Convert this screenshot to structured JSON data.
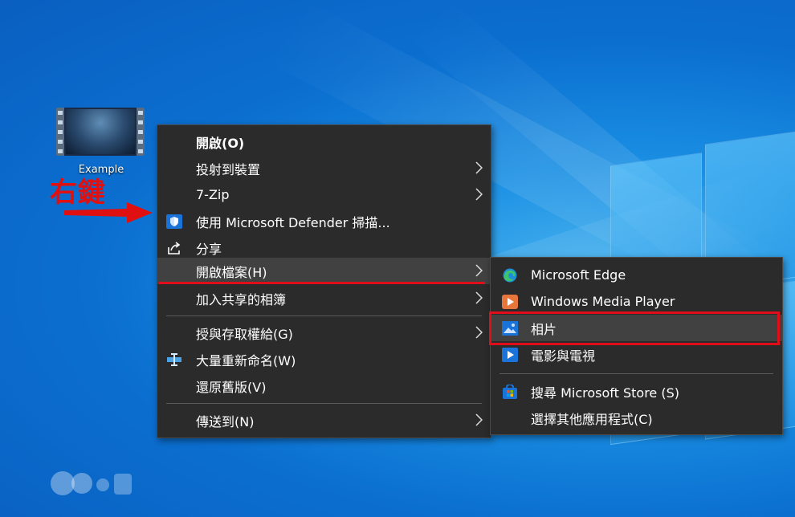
{
  "desktop": {
    "icon_label": "Example",
    "annotation": "右鍵"
  },
  "context_menu": {
    "items": [
      {
        "label": "開啟(O)",
        "bold": true
      },
      {
        "label": "投射到裝置",
        "submenu": true
      },
      {
        "label": "7-Zip",
        "submenu": true
      },
      {
        "label": "使用 Microsoft Defender 掃描...",
        "icon": "defender-shield-icon"
      },
      {
        "label": "分享",
        "icon": "share-icon"
      },
      {
        "label": "開啟檔案(H)",
        "submenu": true,
        "highlighted": true
      },
      {
        "label": "加入共享的相簿",
        "submenu": true
      },
      {
        "label": "授與存取權給(G)",
        "submenu": true
      },
      {
        "label": "大量重新命名(W)",
        "icon": "rename-icon"
      },
      {
        "label": "還原舊版(V)"
      },
      {
        "label": "傳送到(N)",
        "submenu": true
      }
    ]
  },
  "open_with_menu": {
    "items": [
      {
        "label": "Microsoft Edge",
        "icon": "edge-icon"
      },
      {
        "label": "Windows Media Player",
        "icon": "media-player-icon"
      },
      {
        "label": "相片",
        "icon": "photos-icon",
        "highlighted": true
      },
      {
        "label": "電影與電視",
        "icon": "movies-tv-icon"
      },
      {
        "label": "搜尋 Microsoft Store (S)",
        "icon": "store-icon"
      },
      {
        "label": "選擇其他應用程式(C)"
      }
    ]
  },
  "colors": {
    "menu_bg": "#2b2b2b",
    "highlight_bg": "#414141",
    "annotation_red": "#e00d1a"
  }
}
